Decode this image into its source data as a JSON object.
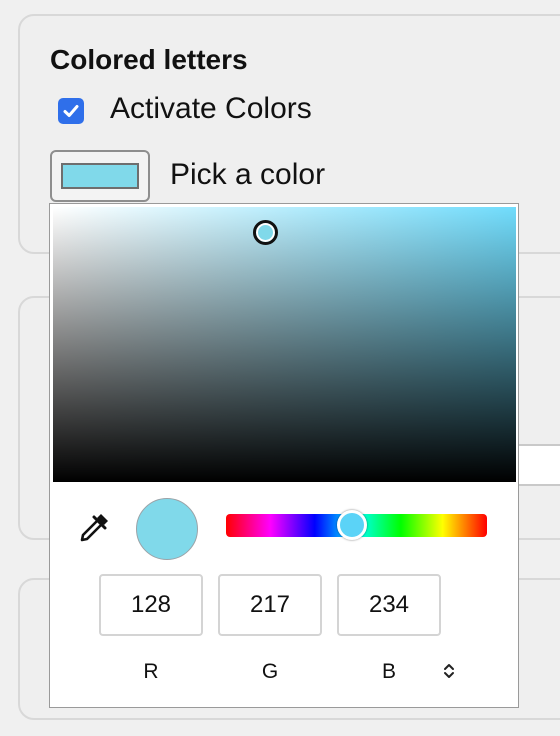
{
  "section": {
    "title": "Colored letters",
    "activate_label": "Activate Colors",
    "activate_checked": true,
    "pick_label": "Pick a color"
  },
  "picker": {
    "current_color": "#80d9ea",
    "hue_color": "#5bd3f7",
    "sv_hue_color": "#70dcfc",
    "rgb": {
      "r": "128",
      "g": "217",
      "b": "234"
    },
    "labels": {
      "r": "R",
      "g": "G",
      "b": "B"
    },
    "icons": {
      "eyedropper": "eyedropper-icon",
      "mode_toggle": "chevron-up-down-icon",
      "check": "checkmark-icon"
    }
  },
  "colors": {
    "accent": "#2f6fea",
    "card_bg": "#efefef",
    "card_border": "#d8d8d8"
  }
}
